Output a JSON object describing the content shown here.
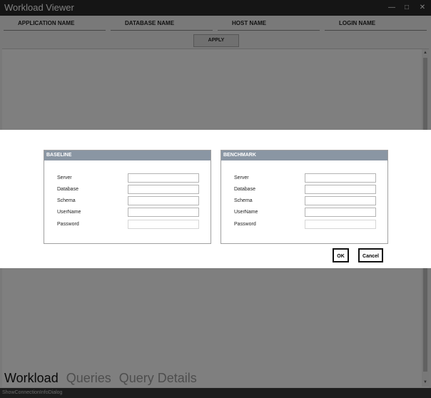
{
  "window": {
    "title": "Workload Viewer",
    "controls": {
      "minimize": "—",
      "maximize": "□",
      "close": "✕"
    }
  },
  "filters": {
    "application_name": "APPLICATION NAME",
    "database_name": "DATABASE NAME",
    "host_name": "HOST NAME",
    "login_name": "LOGIN NAME",
    "apply_label": "APPLY"
  },
  "tabs": {
    "workload": "Workload",
    "queries": "Queries",
    "query_details": "Query Details"
  },
  "statusbar": {
    "text": "ShowConnectionInfoDialog"
  },
  "dialog": {
    "baseline": {
      "title": "BASELINE",
      "server_label": "Server",
      "server_value": "",
      "database_label": "Database",
      "database_value": "",
      "schema_label": "Schema",
      "schema_value": "",
      "username_label": "UserName",
      "username_value": "",
      "password_label": "Password",
      "password_value": ""
    },
    "benchmark": {
      "title": "BENCHMARK",
      "server_label": "Server",
      "server_value": "",
      "database_label": "Database",
      "database_value": "",
      "schema_label": "Schema",
      "schema_value": "",
      "username_label": "UserName",
      "username_value": "",
      "password_label": "Password",
      "password_value": ""
    },
    "ok_label": "OK",
    "cancel_label": "Cancel"
  },
  "colors": {
    "titlebar": "#2b2b2b",
    "group_header": "#8a96a3",
    "overlay": "rgba(0,0,0,0.5)"
  }
}
